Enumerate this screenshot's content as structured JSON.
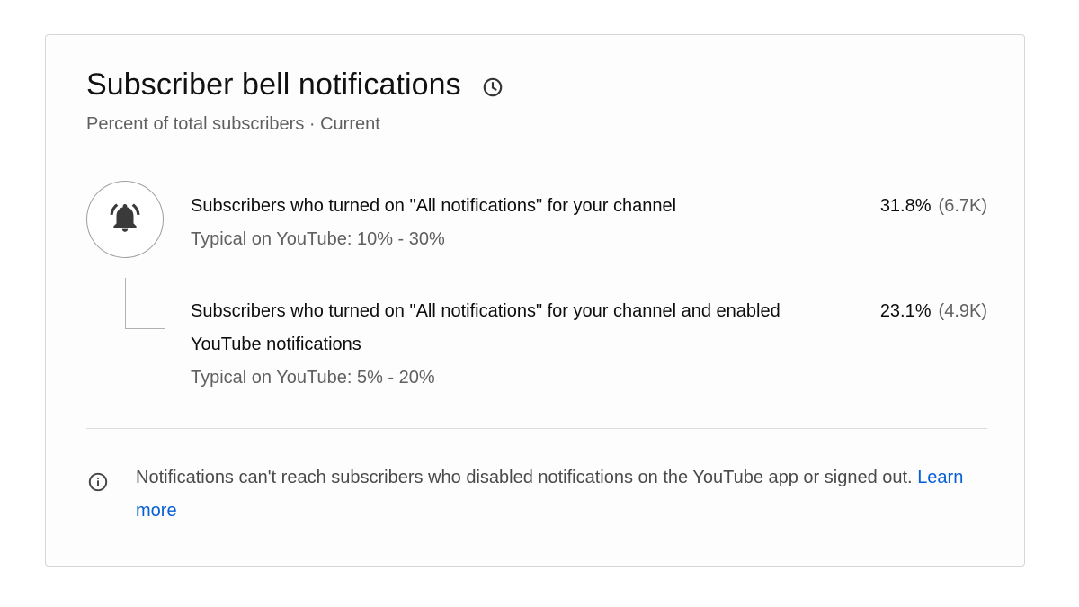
{
  "card": {
    "title": "Subscriber bell notifications",
    "subtitle": "Percent of total subscribers · Current"
  },
  "icons": {
    "title_icon": "history-clock-icon",
    "row_icon": "bell-ringing-icon",
    "note_icon": "info-icon"
  },
  "metrics": [
    {
      "label": "Subscribers who turned on \"All notifications\" for your channel",
      "percent": "31.8%",
      "count": "(6.7K)",
      "typical": "Typical on YouTube: 10% - 30%"
    },
    {
      "label": "Subscribers who turned on \"All notifications\" for your channel and enabled YouTube notifications",
      "percent": "23.1%",
      "count": "(4.9K)",
      "typical": "Typical on YouTube: 5% - 20%"
    }
  ],
  "note": {
    "text": "Notifications can't reach subscribers who disabled notifications on the YouTube app or signed out.",
    "link_label": "Learn more"
  },
  "colors": {
    "link": "#065fd4",
    "secondary_text": "#606060",
    "border": "#d6d6d6"
  }
}
